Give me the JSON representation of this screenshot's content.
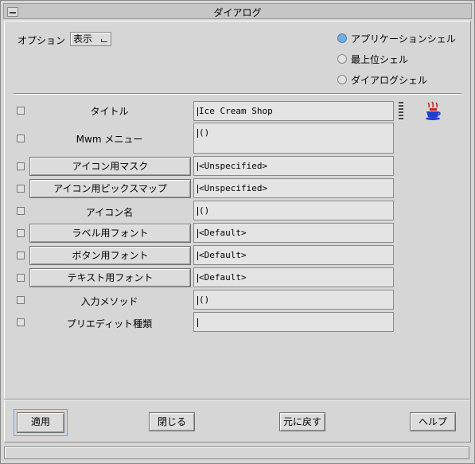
{
  "window": {
    "title": "ダイアログ"
  },
  "option": {
    "label": "オプション",
    "value": "表示"
  },
  "radios": [
    {
      "label": "アプリケーションシェル",
      "selected": true
    },
    {
      "label": "最上位シェル",
      "selected": false
    },
    {
      "label": "ダイアログシェル",
      "selected": false
    }
  ],
  "rows": [
    {
      "label": "タイトル",
      "value": "Ice Cream Shop"
    },
    {
      "label": "Mwm メニュー",
      "value": "()"
    },
    {
      "label": "アイコン用マスク",
      "value": "<Unspecified>"
    },
    {
      "label": "アイコン用ピックスマップ",
      "value": "<Unspecified>"
    },
    {
      "label": "アイコン名",
      "value": "()"
    },
    {
      "label": "ラベル用フォント",
      "value": "<Default>"
    },
    {
      "label": "ボタン用フォント",
      "value": "<Default>"
    },
    {
      "label": "テキスト用フォント",
      "value": "<Default>"
    },
    {
      "label": "入力メソッド",
      "value": "()"
    },
    {
      "label": "プリエディット種類",
      "value": ""
    }
  ],
  "buttons": {
    "apply": "適用",
    "close": "閉じる",
    "reset": "元に戻す",
    "help": "ヘルプ"
  },
  "icons": {
    "window_menu": "window-menu-icon",
    "cup": "coffee-cup-icon",
    "grip": "resize-grip-icon"
  },
  "colors": {
    "background": "#d6d6d6",
    "radio_selected": "#6ab0e8",
    "field": "#e4e4e4"
  }
}
